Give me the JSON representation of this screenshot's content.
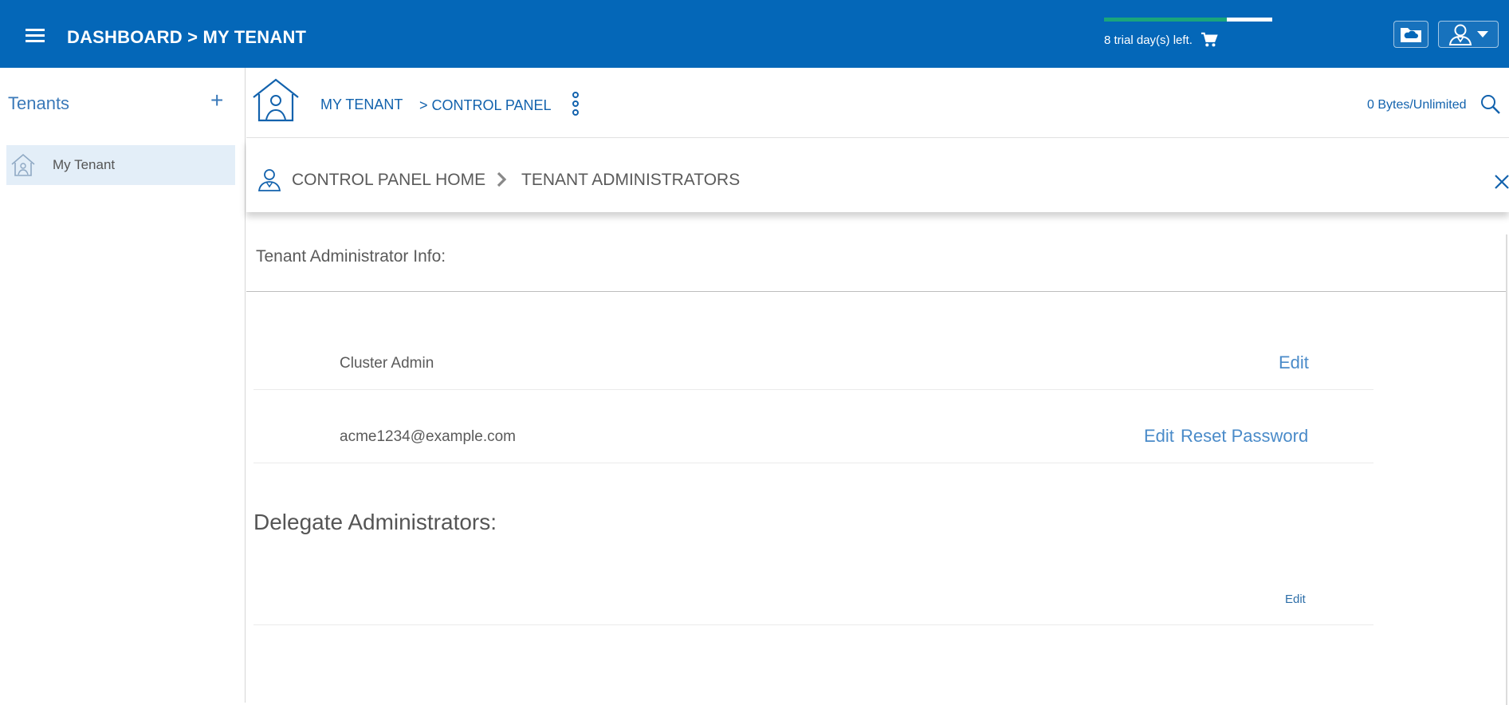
{
  "header": {
    "title": "DASHBOARD > MY TENANT",
    "trial_text": "8 trial day(s) left.",
    "trial_progress": 0.73
  },
  "sidebar": {
    "title": "Tenants",
    "add_label": "+",
    "items": [
      {
        "label": "My Tenant",
        "selected": true
      }
    ]
  },
  "main": {
    "breadcrumb": {
      "tenant": "MY TENANT",
      "section": "> CONTROL PANEL"
    },
    "storage": "0 Bytes/Unlimited",
    "control_panel": {
      "home": "CONTROL PANEL HOME",
      "current": "TENANT ADMINISTRATORS"
    },
    "tenant_admin": {
      "title": "Tenant Administrator Info:",
      "rows": [
        {
          "name": "Cluster Admin",
          "edit": "Edit"
        },
        {
          "name": "acme1234@example.com",
          "edit": "Edit",
          "reset": "Reset Password"
        }
      ]
    },
    "delegate": {
      "title": "Delegate Administrators:",
      "edit": "Edit"
    }
  },
  "colors": {
    "topbar": "#0467b8",
    "accent": "#1262ad",
    "link": "#4a8bc9",
    "selected_bg": "#e3eef8",
    "progress": "#1aa57c"
  },
  "icons": [
    "menu-icon",
    "cart-icon",
    "folder-cloud-icon",
    "user-icon",
    "house-icon",
    "kebab-icon",
    "search-icon",
    "admin-icon",
    "chevron-right-icon",
    "close-icon"
  ]
}
